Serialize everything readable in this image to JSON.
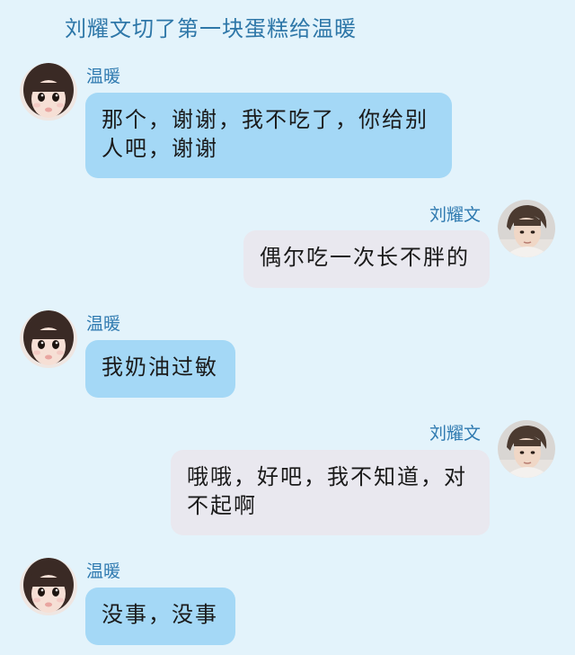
{
  "header": {
    "title": "刘耀文切了第一块蛋糕给温暖"
  },
  "messages": [
    {
      "sender": "温暖",
      "side": "left",
      "text": "那个，谢谢，我不吃了，你给别人吧，谢谢"
    },
    {
      "sender": "刘耀文",
      "side": "right",
      "text": "偶尔吃一次长不胖的"
    },
    {
      "sender": "温暖",
      "side": "left",
      "text": "我奶油过敏"
    },
    {
      "sender": "刘耀文",
      "side": "right",
      "text": "哦哦，好吧，我不知道，对不起啊"
    },
    {
      "sender": "温暖",
      "side": "left",
      "text": "没事，没事"
    }
  ],
  "colors": {
    "background": "#e3f3fb",
    "left_bubble": "#a4d8f6",
    "right_bubble": "#e9e8ef",
    "name_text": "#2f7ab0"
  },
  "icons": {
    "left_avatar": "girl-avatar-photo",
    "right_avatar": "boy-avatar-photo"
  }
}
